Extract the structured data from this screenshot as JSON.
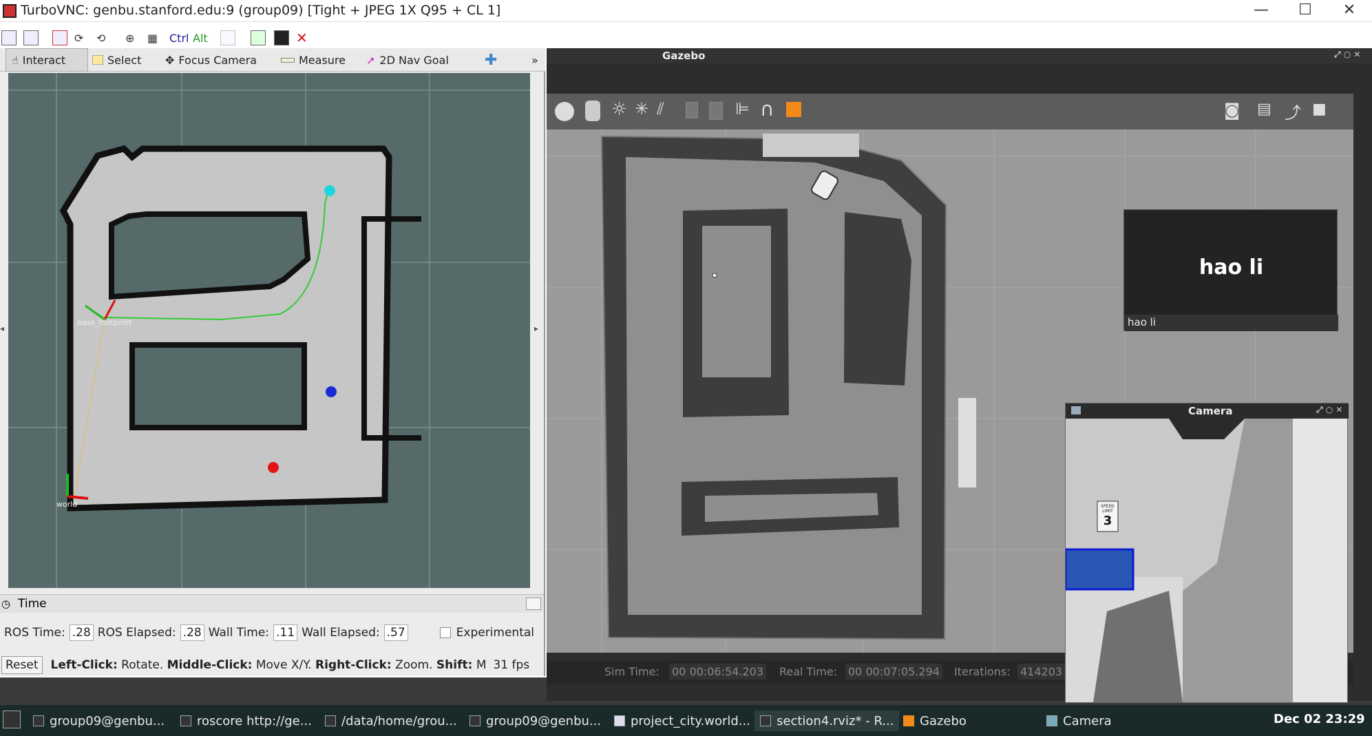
{
  "window": {
    "title": "TurboVNC: genbu.stanford.edu:9 (group09) [Tight + JPEG 1X Q95 + CL 1]",
    "min": "—",
    "max": "☐",
    "close": "✕"
  },
  "vnc_toolbar": {
    "ctrl": "Ctrl",
    "alt": "Alt",
    "close_icon": "✕"
  },
  "rviz": {
    "tools": [
      {
        "label": "Interact"
      },
      {
        "label": "Select"
      },
      {
        "label": "Focus Camera"
      },
      {
        "label": "Measure"
      },
      {
        "label": "2D Nav Goal"
      }
    ],
    "overflow": "»",
    "labels": {
      "base": "base_footprint",
      "world": "world"
    },
    "time_title": "Time",
    "time": {
      "ros_time_label": "ROS Time:",
      "ros_time": ".28",
      "ros_elapsed_label": "ROS Elapsed:",
      "ros_elapsed": ".28",
      "wall_time_label": "Wall Time:",
      "wall_time": ".11",
      "wall_elapsed_label": "Wall Elapsed:",
      "wall_elapsed": ".57",
      "experimental": "Experimental"
    },
    "help": {
      "reset": "Reset",
      "left_click": "Left-Click:",
      "rotate": "Rotate.",
      "middle_click": "Middle-Click:",
      "move": "Move X/Y.",
      "right_click": "Right-Click:",
      "zoom": "Zoom.",
      "shift": "Shift:",
      "m": "M",
      "fps": "31 fps"
    }
  },
  "gazebo": {
    "title": "Gazebo",
    "status": {
      "sim_label": "Sim Time:",
      "sim": "00 00:06:54.203",
      "real_label": "Real Time:",
      "real": "00 00:07:05.294",
      "iter_label": "Iterations:",
      "iter": "414203"
    },
    "caption_large": "hao li",
    "caption_small": "hao li",
    "camera_title": "Camera",
    "sign_top": "SPEED LIMIT",
    "sign_num": "3"
  },
  "taskbar": {
    "items": [
      {
        "label": "group09@genbu..."
      },
      {
        "label": "roscore http://ge..."
      },
      {
        "label": "/data/home/grou..."
      },
      {
        "label": "group09@genbu..."
      },
      {
        "label": "project_city.world..."
      },
      {
        "label": "section4.rviz* - R..."
      },
      {
        "label": "Gazebo"
      },
      {
        "label": "Camera"
      }
    ],
    "clock": "Dec 02 23:29"
  }
}
